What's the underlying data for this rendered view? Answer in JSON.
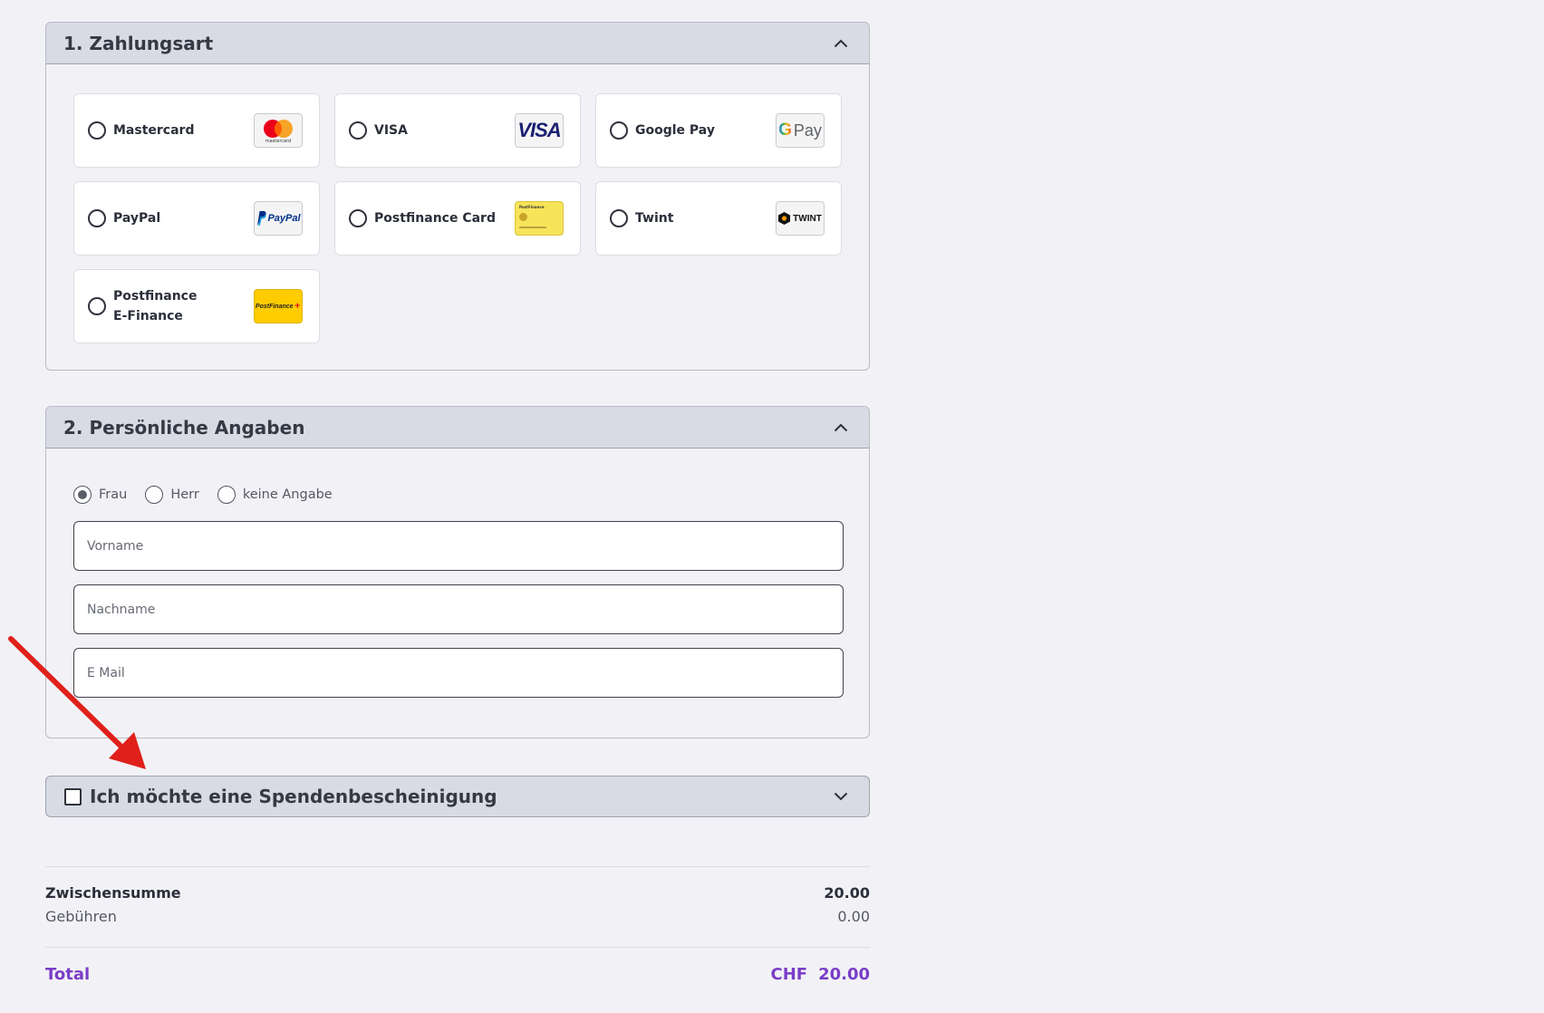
{
  "payment": {
    "title": "1. Zahlungsart",
    "methods": [
      {
        "label": "Mastercard",
        "logo": "mastercard-logo",
        "logo_text": "mastercard"
      },
      {
        "label": "VISA",
        "logo": "visa-logo",
        "logo_text": "VISA"
      },
      {
        "label": "Google Pay",
        "logo": "google-pay-logo",
        "logo_text": "Pay"
      },
      {
        "label": "PayPal",
        "logo": "paypal-logo",
        "logo_text": "PayPal"
      },
      {
        "label": "Postfinance Card",
        "logo": "postfinance-card-logo",
        "logo_text": "PostFinance"
      },
      {
        "label": "Twint",
        "logo": "twint-logo",
        "logo_text": "TWINT"
      },
      {
        "label_line1": "Postfinance",
        "label_line2": "E-Finance",
        "logo": "postfinance-efinance-logo",
        "logo_text": "PostFinance"
      }
    ]
  },
  "personal": {
    "title": "2. Persönliche Angaben",
    "salutations": [
      {
        "label": "Frau",
        "selected": true
      },
      {
        "label": "Herr",
        "selected": false
      },
      {
        "label": "keine Angabe",
        "selected": false
      }
    ],
    "fields": {
      "firstname_placeholder": "Vorname",
      "lastname_placeholder": "Nachname",
      "email_placeholder": "E Mail"
    }
  },
  "donation": {
    "label": "Ich möchte eine Spendenbescheinigung",
    "checked": false
  },
  "summary": {
    "subtotal_label": "Zwischensumme",
    "subtotal_value": "20.00",
    "fees_label": "Gebühren",
    "fees_value": "0.00",
    "total_label": "Total",
    "currency": "CHF",
    "total_value": "20.00"
  },
  "colors": {
    "accent": "#7a3dc7",
    "header_bg": "#d8dbe3",
    "page_bg": "#f2f2f6",
    "annotation": "#e0201b"
  }
}
